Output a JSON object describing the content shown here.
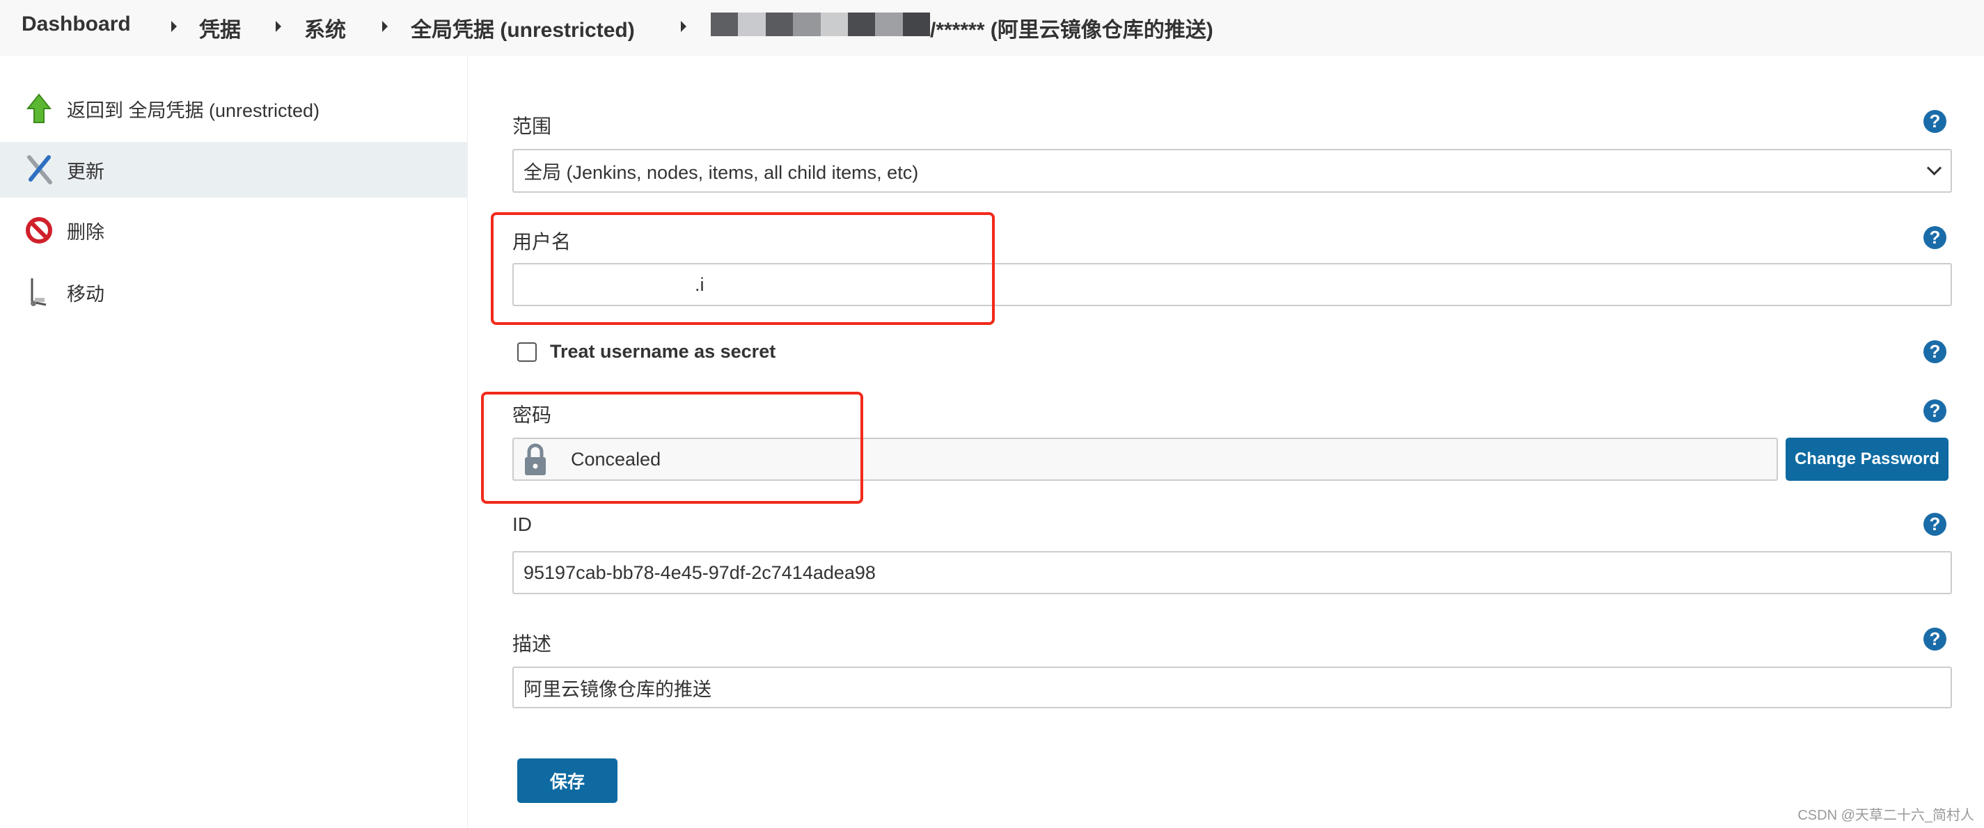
{
  "breadcrumb": {
    "items": [
      "Dashboard",
      "凭据",
      "系统",
      "全局凭据 (unrestricted)"
    ],
    "current_suffix": "/****** (阿里云镜像仓库的推送)",
    "redacted_colors": [
      "#5e5f63",
      "#c9cacd",
      "#5a5b5f",
      "#96979a",
      "#cbccce",
      "#4b4c50",
      "#9fa0a3",
      "#444548"
    ]
  },
  "sidebar": {
    "items": [
      {
        "label": "返回到 全局凭据 (unrestricted)",
        "icon": "up-arrow-icon"
      },
      {
        "label": "更新",
        "icon": "wrench-screwdriver-icon",
        "active": true
      },
      {
        "label": "删除",
        "icon": "no-entry-icon"
      },
      {
        "label": "移动",
        "icon": "hand-truck-icon"
      }
    ]
  },
  "form": {
    "scope": {
      "label": "范围",
      "value": "全局 (Jenkins, nodes, items, all child items, etc)"
    },
    "username": {
      "label": "用户名",
      "value": ".i"
    },
    "treat_secret": {
      "label": "Treat username as secret",
      "checked": false
    },
    "password": {
      "label": "密码",
      "value": "Concealed",
      "change_button": "Change Password"
    },
    "id": {
      "label": "ID",
      "value": "95197cab-bb78-4e45-97df-2c7414adea98"
    },
    "description": {
      "label": "描述",
      "value": "阿里云镜像仓库的推送"
    },
    "help_glyph": "?",
    "save_button": "保存"
  },
  "colors": {
    "accent": "#0e6aa1",
    "annotation": "#f22a1a"
  },
  "watermark": "CSDN @天草二十六_简村人"
}
